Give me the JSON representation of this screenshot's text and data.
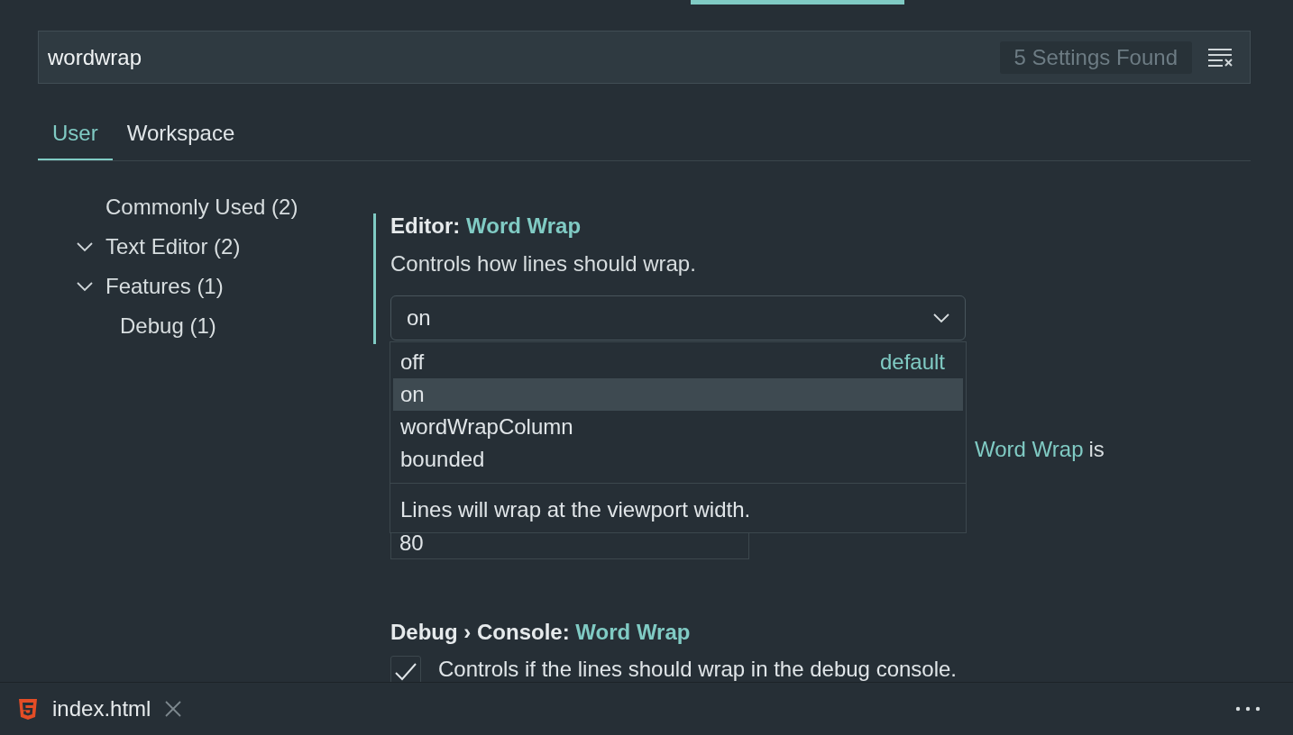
{
  "search": {
    "value": "wordwrap",
    "result_count": "5 Settings Found"
  },
  "scope_tabs": [
    {
      "label": "User",
      "selected": true
    },
    {
      "label": "Workspace",
      "selected": false
    }
  ],
  "toc": [
    {
      "label": "Commonly Used (2)"
    },
    {
      "label": "Text Editor (2)",
      "expanded": true
    },
    {
      "label": "Features (1)",
      "expanded": true,
      "children": [
        {
          "label": "Debug (1)"
        }
      ]
    }
  ],
  "settings": [
    {
      "kind": "select",
      "focused": true,
      "category": "Editor:",
      "name": "Word Wrap",
      "description": "Controls how lines should wrap.",
      "value": "on",
      "open": true,
      "dropdown": {
        "options": [
          {
            "label": "off",
            "note": "default",
            "selected": false
          },
          {
            "label": "on",
            "selected": true
          },
          {
            "label": "wordWrapColumn",
            "selected": false
          },
          {
            "label": "bounded",
            "selected": false
          }
        ],
        "description": "Lines will wrap at the viewport width."
      }
    },
    {
      "kind": "number",
      "focused": false,
      "description_link": "Word Wrap",
      "description_end": "is",
      "value": "80"
    },
    {
      "kind": "checkbox",
      "focused": false,
      "category": "Debug › Console:",
      "name": "Word Wrap",
      "description": "Controls if the lines should wrap in the debug console.",
      "checked": true
    }
  ],
  "editor_tabs": [
    {
      "label": "index.html"
    }
  ]
}
